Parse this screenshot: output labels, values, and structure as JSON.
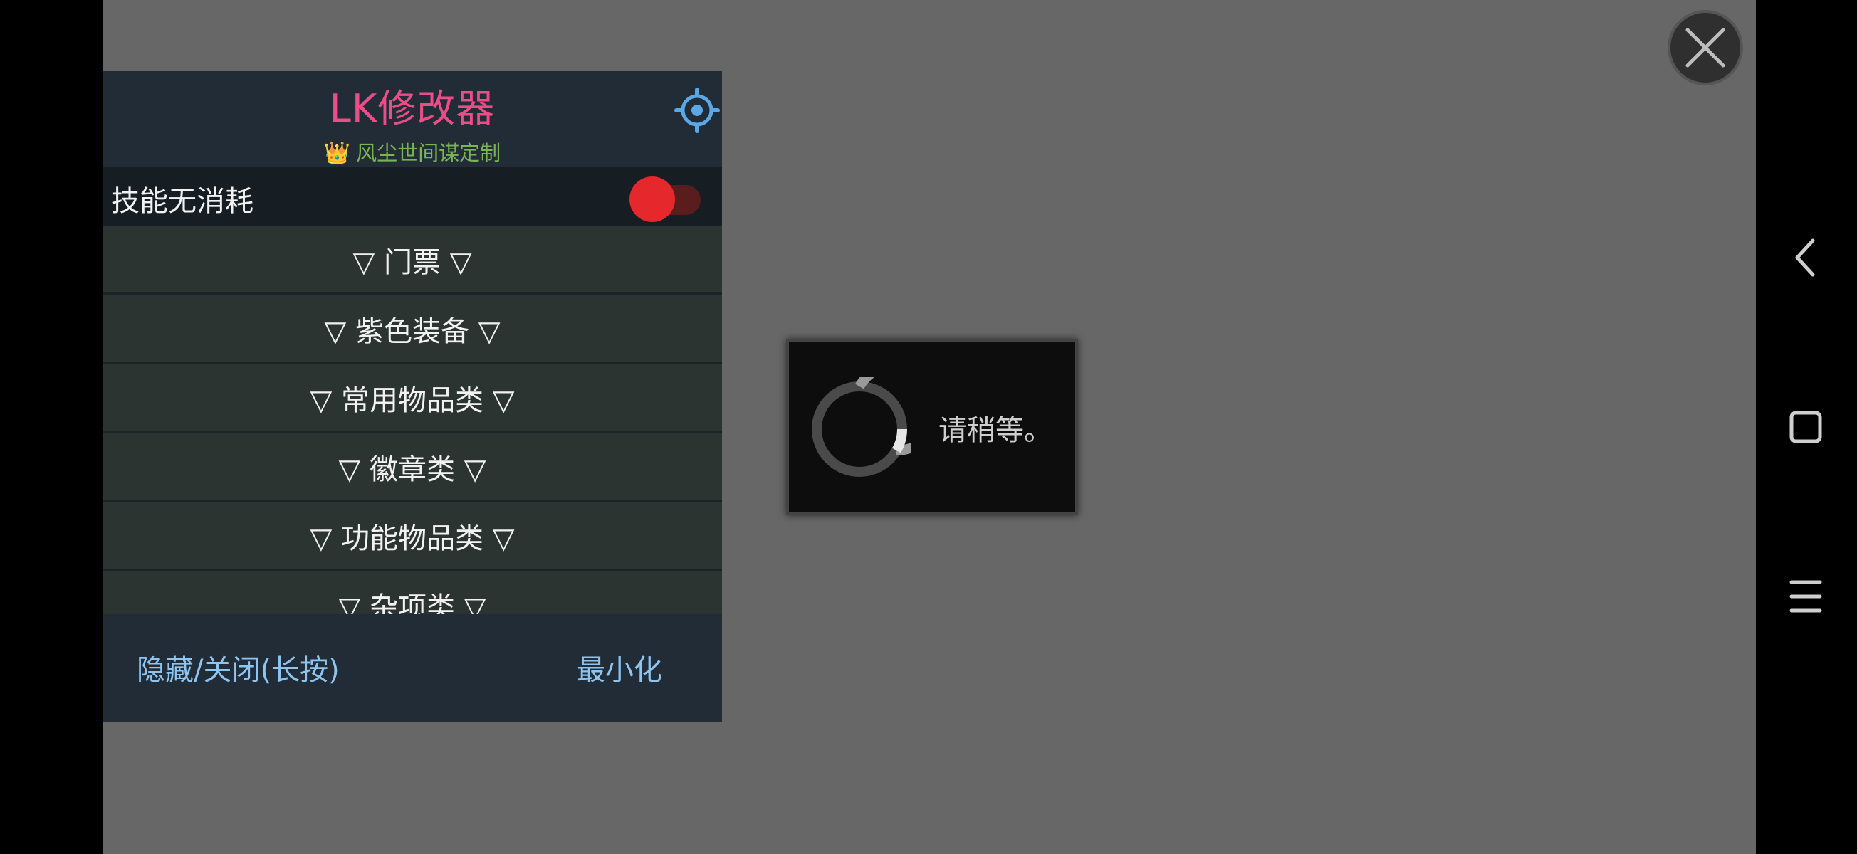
{
  "menu": {
    "title": "LK修改器",
    "subtitle_icon": "crown-icon",
    "subtitle_glyph": "👑",
    "subtitle": "风尘世间谋定制",
    "settings_icon": "gear-icon",
    "toggle": {
      "label": "技能无消耗",
      "state": "on"
    },
    "categories": [
      {
        "label": "▽ 门票 ▽"
      },
      {
        "label": "▽ 紫色装备 ▽"
      },
      {
        "label": "▽ 常用物品类 ▽"
      },
      {
        "label": "▽ 徽章类 ▽"
      },
      {
        "label": "▽ 功能物品类 ▽"
      },
      {
        "label": "▽ 杂项类 ▽"
      }
    ],
    "footer": {
      "hide_label": "隐藏/关闭(长按)",
      "minimize_label": "最小化"
    }
  },
  "dialog": {
    "text": "请稍等。",
    "icon": "spinner-icon"
  },
  "floating_close": {
    "icon": "close-icon"
  },
  "system_nav": {
    "back_icon": "back-icon",
    "home_icon": "home-icon",
    "menu_icon": "menu-icon"
  },
  "colors": {
    "title": "#ea4d87",
    "subtitle": "#79b552",
    "toggle_on": "#e5282c",
    "footer_link": "#8dc4f0",
    "backdrop": "#676767"
  }
}
